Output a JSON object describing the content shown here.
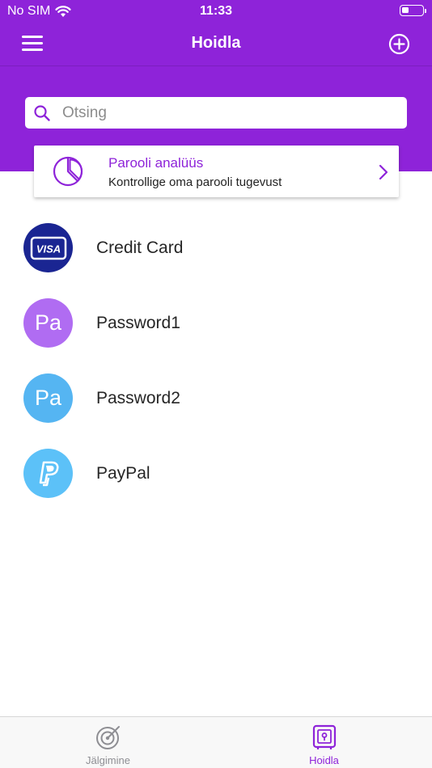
{
  "status_bar": {
    "carrier": "No SIM",
    "time": "11:33",
    "battery_level": 0.35,
    "wifi_icon": "wifi-icon",
    "battery_icon": "battery-icon"
  },
  "nav": {
    "title": "Hoidla",
    "menu_icon": "hamburger-menu-icon",
    "add_icon": "plus-circle-icon"
  },
  "search": {
    "placeholder": "Otsing",
    "value": "",
    "icon": "search-icon"
  },
  "analysis_card": {
    "title": "Parooli analüüs",
    "subtitle": "Kontrollige oma parooli tugevust",
    "icon": "pie-chart-icon",
    "chevron_icon": "chevron-right-icon"
  },
  "items": [
    {
      "label": "Credit Card",
      "avatar_text": "VISA",
      "avatar_icon": "visa-card-icon",
      "avatar_color": "#1a2592"
    },
    {
      "label": "Password1",
      "avatar_text": "Pa",
      "avatar_color": "#b06cf2"
    },
    {
      "label": "Password2",
      "avatar_text": "Pa",
      "avatar_color": "#55b5f2"
    },
    {
      "label": "PayPal",
      "avatar_text": "",
      "avatar_icon": "paypal-icon",
      "avatar_color": "#5cc1f8"
    }
  ],
  "tabs": [
    {
      "label": "Jälgimine",
      "icon": "radar-icon",
      "active": false
    },
    {
      "label": "Hoidla",
      "icon": "vault-icon",
      "active": true
    }
  ],
  "colors": {
    "primary": "#8e23d9",
    "tab_inactive": "#8e8e93"
  }
}
